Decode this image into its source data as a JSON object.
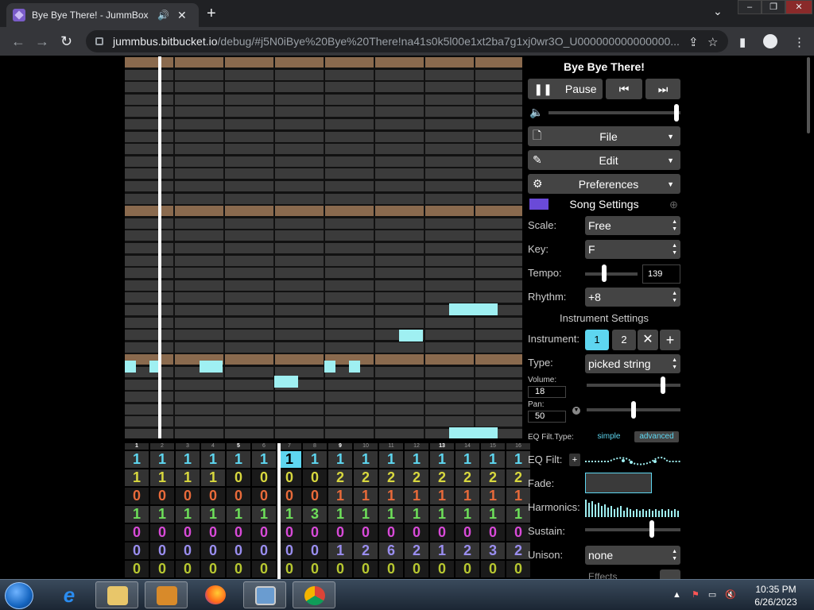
{
  "browser": {
    "tab_title": "Bye Bye There! - JummBox 2.",
    "url_host": "jummbus.bitbucket.io",
    "url_path": "/debug/#j5N0iBye%20Bye%20There!na41s0k5l00e1xt2ba7g1xj0wr3O_U000000000000000..."
  },
  "player": {
    "song_title": "Bye Bye There!",
    "pause_label": "Pause",
    "volume_level": 0.97
  },
  "menus": {
    "file_label": "File",
    "edit_label": "Edit",
    "preferences_label": "Preferences"
  },
  "song_settings": {
    "header": "Song Settings",
    "scale_label": "Scale:",
    "scale_value": "Free",
    "key_label": "Key:",
    "key_value": "F",
    "tempo_label": "Tempo:",
    "tempo_value": "139",
    "tempo_level": 0.37,
    "rhythm_label": "Rhythm:",
    "rhythm_value": "+8"
  },
  "instrument_settings": {
    "header": "Instrument Settings",
    "instrument_label": "Instrument:",
    "instruments": [
      "1",
      "2"
    ],
    "type_label": "Type:",
    "type_value": "picked string",
    "volume_label": "Volume:",
    "volume_value": "18",
    "volume_level": 0.81,
    "pan_label": "Pan:",
    "pan_value": "50",
    "pan_level": 0.5,
    "eq_type_label": "EQ Filt.Type:",
    "eq_simple": "simple",
    "eq_advanced": "advanced",
    "eq_filt_label": "EQ Filt:",
    "fade_label": "Fade:",
    "harmonics_label": "Harmonics:",
    "sustain_label": "Sustain:",
    "sustain_level": 0.7,
    "unison_label": "Unison:",
    "unison_value": "none",
    "effects_label": "Effects"
  },
  "bar_numbers": [
    "1",
    "2",
    "3",
    "4",
    "5",
    "6",
    "7",
    "8",
    "9",
    "10",
    "11",
    "12",
    "13",
    "14",
    "15",
    "16"
  ],
  "tracks": [
    {
      "color": "#5ed6f0",
      "values": [
        "1",
        "1",
        "1",
        "1",
        "1",
        "1",
        "1",
        "1",
        "1",
        "1",
        "1",
        "1",
        "1",
        "1",
        "1",
        "1"
      ]
    },
    {
      "color": "#d8d83e",
      "values": [
        "1",
        "1",
        "1",
        "1",
        "0",
        "0",
        "0",
        "0",
        "2",
        "2",
        "2",
        "2",
        "2",
        "2",
        "2",
        "2"
      ]
    },
    {
      "color": "#e86a3a",
      "values": [
        "0",
        "0",
        "0",
        "0",
        "0",
        "0",
        "0",
        "0",
        "1",
        "1",
        "1",
        "1",
        "1",
        "1",
        "1",
        "1"
      ]
    },
    {
      "color": "#6ee05a",
      "values": [
        "1",
        "1",
        "1",
        "1",
        "1",
        "1",
        "1",
        "3",
        "1",
        "1",
        "1",
        "1",
        "1",
        "1",
        "1",
        "1"
      ]
    },
    {
      "color": "#d84ad8",
      "values": [
        "0",
        "0",
        "0",
        "0",
        "0",
        "0",
        "0",
        "0",
        "0",
        "0",
        "0",
        "0",
        "0",
        "0",
        "0",
        "0"
      ]
    },
    {
      "color": "#9a8ef0",
      "values": [
        "0",
        "0",
        "0",
        "0",
        "0",
        "0",
        "0",
        "0",
        "1",
        "2",
        "6",
        "2",
        "1",
        "2",
        "3",
        "2"
      ]
    },
    {
      "color": "#b8c830",
      "values": [
        "0",
        "0",
        "0",
        "0",
        "0",
        "0",
        "0",
        "0",
        "0",
        "0",
        "0",
        "0",
        "0",
        "0",
        "0",
        "0"
      ]
    }
  ],
  "taskbar": {
    "time": "10:35 PM",
    "date": "6/26/2023"
  },
  "colors": {
    "accent": "#9ff0f2",
    "octave_row": "#8a6a4e",
    "grid_cell": "#3b3b3b"
  }
}
